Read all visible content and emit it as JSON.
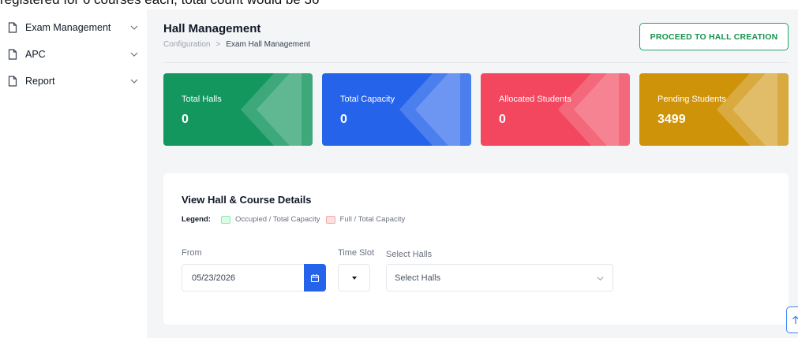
{
  "overlay_text": "registered for 6 courses each, total count would be 36",
  "sidebar": {
    "items": [
      {
        "label": "Exam Management",
        "icon": "document-icon"
      },
      {
        "label": "APC",
        "icon": "document-icon"
      },
      {
        "label": "Report",
        "icon": "document-icon"
      }
    ]
  },
  "header": {
    "title": "Hall Management",
    "breadcrumb": {
      "root": "Configuration",
      "separator": ">",
      "current": "Exam Hall Management"
    },
    "proceed_button": "PROCEED TO HALL CREATION"
  },
  "cards": [
    {
      "label": "Total Halls",
      "value": "0",
      "color": "#13975f"
    },
    {
      "label": "Total Capacity",
      "value": "0",
      "color": "#2563eb"
    },
    {
      "label": "Allocated Students",
      "value": "0",
      "color": "#f2475f"
    },
    {
      "label": "Pending Students",
      "value": "3499",
      "color": "#cf930a"
    }
  ],
  "details": {
    "title": "View Hall & Course Details",
    "legend": {
      "title": "Legend:",
      "occupied": "Occupied / Total Capacity",
      "full": "Full / Total Capacity"
    },
    "from_label": "From",
    "from_value": "05/23/2026",
    "time_slot_label": "Time Slot",
    "halls_label": "Select Halls",
    "halls_placeholder": "Select Halls"
  },
  "colors": {
    "accent_green": "#16924f",
    "accent_blue": "#2563eb"
  }
}
